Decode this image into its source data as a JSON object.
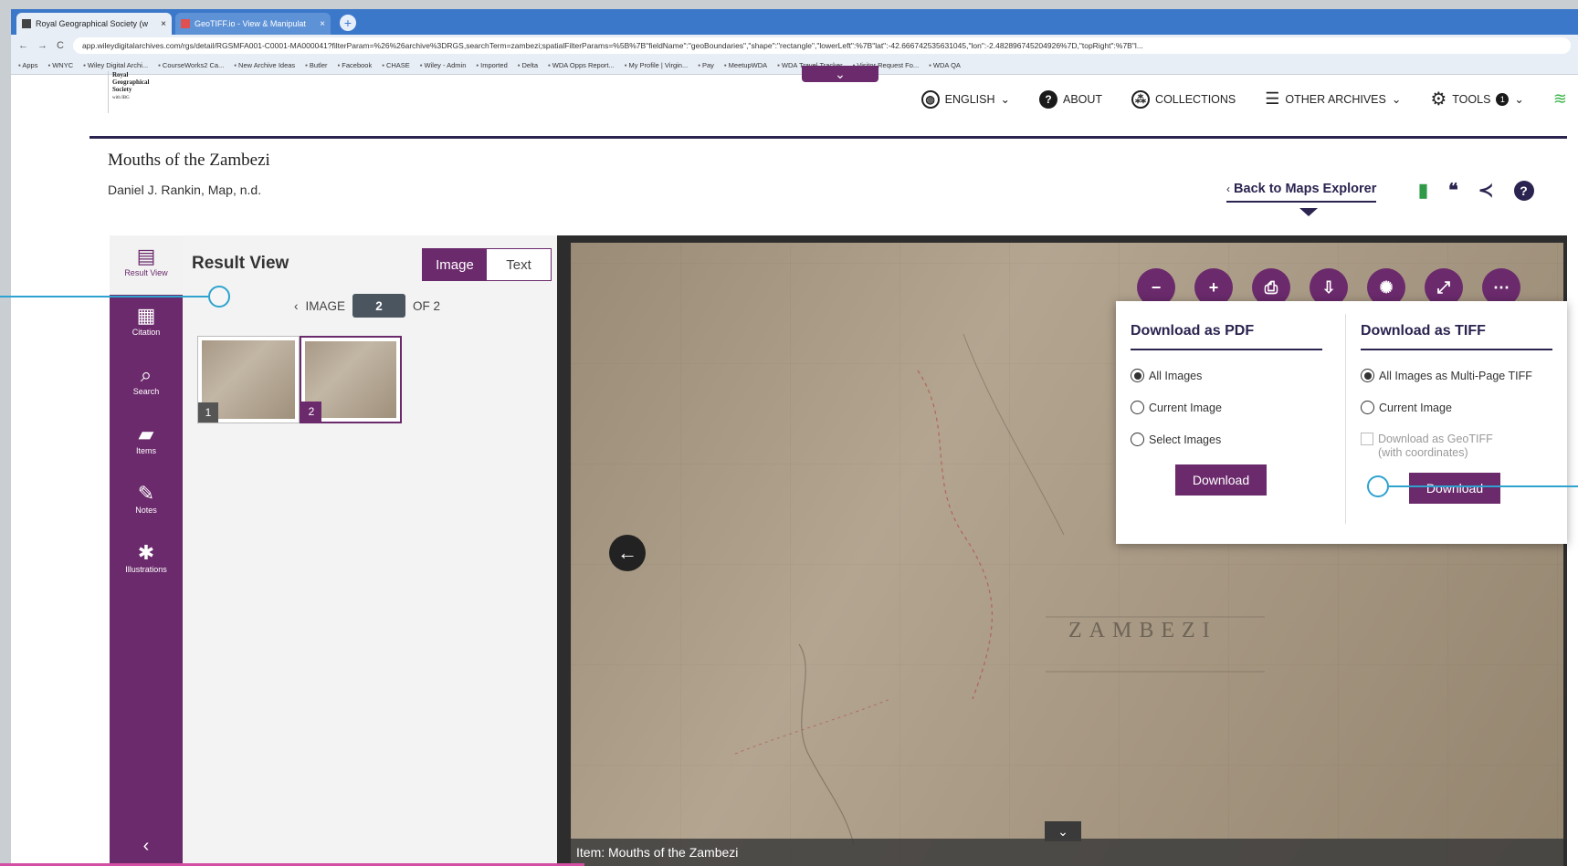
{
  "browser": {
    "tabs": [
      {
        "title": "Royal Geographical Society (w",
        "close": "×"
      },
      {
        "title": "GeoTIFF.io - View & Manipulat",
        "close": "×"
      }
    ],
    "new_tab": "+",
    "back": "←",
    "forward": "→",
    "reload": "C",
    "url": "app.wileydigitalarchives.com/rgs/detail/RGSMFA001-C0001-MA000041?filterParam=%26%26archive%3DRGS,searchTerm=zambezi;spatialFilterParams=%5B%7B\"fieldName\":\"geoBoundaries\",\"shape\":\"rectangle\",\"lowerLeft\":%7B\"lat\":-42.666742535631045,\"lon\":-2.482896745204926%7D,\"topRight\":%7B\"l...",
    "bookmarks": [
      "Apps",
      "WNYC",
      "Wiley Digital Archi...",
      "CourseWorks2 Ca...",
      "New Archive Ideas",
      "Butler",
      "Facebook",
      "CHASE",
      "Wiley - Admin",
      "Imported",
      "Delta",
      "WDA Opps Report...",
      "My Profile | Virgin...",
      "Pay",
      "MeetupWDA",
      "WDA Travel Tracker",
      "Visitor Request Fo...",
      "WDA QA"
    ]
  },
  "header": {
    "logo_lines": [
      "Royal",
      "Geographical",
      "Society",
      "with IBG"
    ],
    "handle_icon": "chevron-down",
    "nav": [
      {
        "label": "ENGLISH",
        "caret": "⌄"
      },
      {
        "label": "ABOUT"
      },
      {
        "label": "COLLECTIONS"
      },
      {
        "label": "OTHER ARCHIVES",
        "caret": "⌄"
      },
      {
        "label": "TOOLS",
        "badge": "1",
        "caret": "⌄"
      }
    ]
  },
  "doc": {
    "title": "Mouths of the Zambezi",
    "subtitle": "Daniel J. Rankin, Map, n.d.",
    "back_link": "Back to Maps Explorer"
  },
  "rail": {
    "items": [
      {
        "label": "Result View",
        "icon": "document-icon"
      },
      {
        "label": "Citation",
        "icon": "citation-icon"
      },
      {
        "label": "Search",
        "icon": "search-icon"
      },
      {
        "label": "Items",
        "icon": "folder-icon"
      },
      {
        "label": "Notes",
        "icon": "notes-icon"
      },
      {
        "label": "Illustrations",
        "icon": "palette-icon"
      }
    ],
    "collapse": "‹"
  },
  "result_view": {
    "title": "Result View",
    "toggle": {
      "image": "Image",
      "text": "Text"
    },
    "pager": {
      "prefix": "IMAGE",
      "current": "2",
      "suffix": "OF 2"
    },
    "thumbs": [
      {
        "num": "1"
      },
      {
        "num": "2"
      }
    ]
  },
  "viewer": {
    "caption": "Item: Mouths of the Zambezi",
    "map_labels": [
      "ZAMBEZI"
    ],
    "tools": [
      "zoom-out-icon",
      "zoom-in-icon",
      "print-icon",
      "download-icon",
      "brightness-icon",
      "fullscreen-icon",
      "more-icon"
    ]
  },
  "download": {
    "pdf": {
      "heading": "Download as PDF",
      "options": [
        "All Images",
        "Current Image",
        "Select Images"
      ],
      "selected": 0,
      "button": "Download"
    },
    "tiff": {
      "heading": "Download as TIFF",
      "options": [
        "All Images as Multi-Page TIFF",
        "Current Image"
      ],
      "selected": 0,
      "geotiff_label": "Download as GeoTIFF",
      "geotiff_sub": "(with coordinates)",
      "button": "Download"
    }
  },
  "colors": {
    "accent": "#6b2a6c",
    "navy": "#2b2450",
    "callout": "#2ea3cf"
  }
}
